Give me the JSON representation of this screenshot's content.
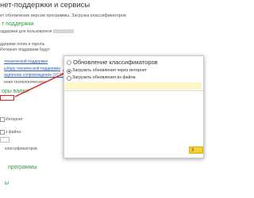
{
  "page": {
    "title": "нет-поддержки и сервисы",
    "subtitle": "ет обновление версии программы. Загрузка классификаторов"
  },
  "left_panel": {
    "support_heading": "т поддержки",
    "user_label": "оддержки для пользователя",
    "item1": "ддержки логин и пароль",
    "item2": "Интернет-поддержки будут",
    "links": [
      "технической поддержки",
      "ыбору технической поддержки",
      "ационное сопровождение (1С:ИТС)",
      "ения технологического"
    ],
    "section_heading": "оры валют",
    "red_box_text": "",
    "internet_text": "Интернет",
    "files_text": "з файла",
    "classifiers_heading": "классификаторов",
    "bottom_heading1": "программы",
    "bottom_heading2": "ы"
  },
  "dialog": {
    "title": "Обновление классификаторов",
    "options": [
      {
        "label": "Загрузить обновления через интернет",
        "selected": true
      },
      {
        "label": "Загрузить обновления из файла",
        "selected": false
      }
    ],
    "button_label": "З"
  },
  "colors": {
    "green": "#2e9d3f",
    "link": "#2b5fb3",
    "red_annotation": "#e02020",
    "highlight": "#fff6c8",
    "button": "#f7d12e"
  }
}
